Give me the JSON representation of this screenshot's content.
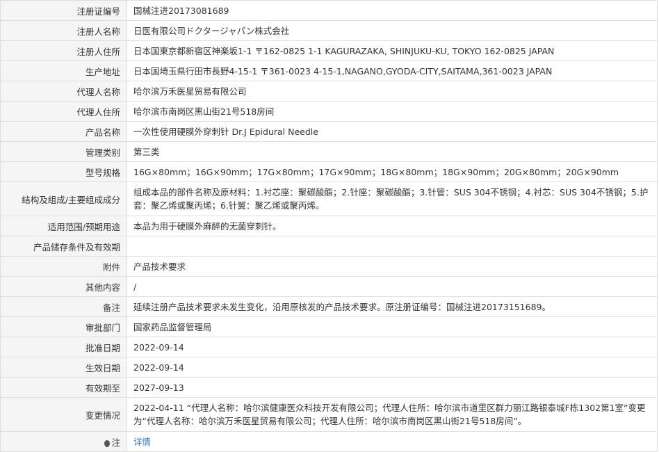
{
  "rows": [
    {
      "label": "注册证编号",
      "value": "国械注进20173081689"
    },
    {
      "label": "注册人名称",
      "value": "日医有限公司ドクタージャパン株式会社"
    },
    {
      "label": "注册人住所",
      "value": "日本国東京都新宿区神楽坂1-1 〒162-0825 1-1 KAGURAZAKA, SHINJUKU-KU, TOKYO 162-0825 JAPAN"
    },
    {
      "label": "生产地址",
      "value": "日本国埼玉県行田市長野4-15-1 〒361-0023 4-15-1,NAGANO,GYODA-CITY,SAITAMA,361-0023 JAPAN"
    },
    {
      "label": "代理人名称",
      "value": "哈尔滨万禾医星贸易有限公司"
    },
    {
      "label": "代理人住所",
      "value": "哈尔滨市南岗区黑山街21号518房间"
    },
    {
      "label": "产品名称",
      "value": "一次性使用硬膜外穿刺针 Dr.J Epidural Needle"
    },
    {
      "label": "管理类别",
      "value": "第三类"
    },
    {
      "label": "型号规格",
      "value": "16G×80mm；16G×90mm；17G×80mm；17G×90mm；18G×80mm；18G×90mm；20G×80mm；20G×90mm"
    },
    {
      "label": "结构及组成/主要组成成分",
      "value": "组成本品的部件名称及原材料：1.衬芯座：聚碳酸酯；2.针座：聚碳酸酯；3.针管：SUS 304不锈钢；4.衬芯：SUS 304不锈钢；5.护套：聚乙烯或聚丙烯；6.针翼：聚乙烯或聚丙烯。"
    },
    {
      "label": "适用范围/预期用途",
      "value": "本品为用于硬膜外麻醉的无菌穿刺针。"
    },
    {
      "label": "产品储存条件及有效期",
      "value": ""
    },
    {
      "label": "附件",
      "value": "产品技术要求"
    },
    {
      "label": "其他内容",
      "value": "/"
    },
    {
      "label": "备注",
      "value": "延续注册产品技术要求未发生变化，沿用原核发的产品技术要求。原注册证编号：国械注进20173151689。"
    },
    {
      "label": "审批部门",
      "value": "国家药品监督管理局"
    },
    {
      "label": "批准日期",
      "value": "2022-09-14"
    },
    {
      "label": "生效日期",
      "value": "2022-09-14"
    },
    {
      "label": "有效期至",
      "value": "2027-09-13"
    },
    {
      "label": "变更情况",
      "value": "2022-04-11 “代理人名称：哈尔滨健康医众科技开发有限公司；代理人住所：哈尔滨市道里区群力丽江路银泰城F栋1302第1室”变更为“代理人名称：哈尔滨万禾医星贸易有限公司；代理人住所：哈尔滨市南岗区黑山街21号518房间”。"
    }
  ],
  "note": {
    "label": "注",
    "link": "详情",
    "icon": "lightbulb-icon"
  }
}
